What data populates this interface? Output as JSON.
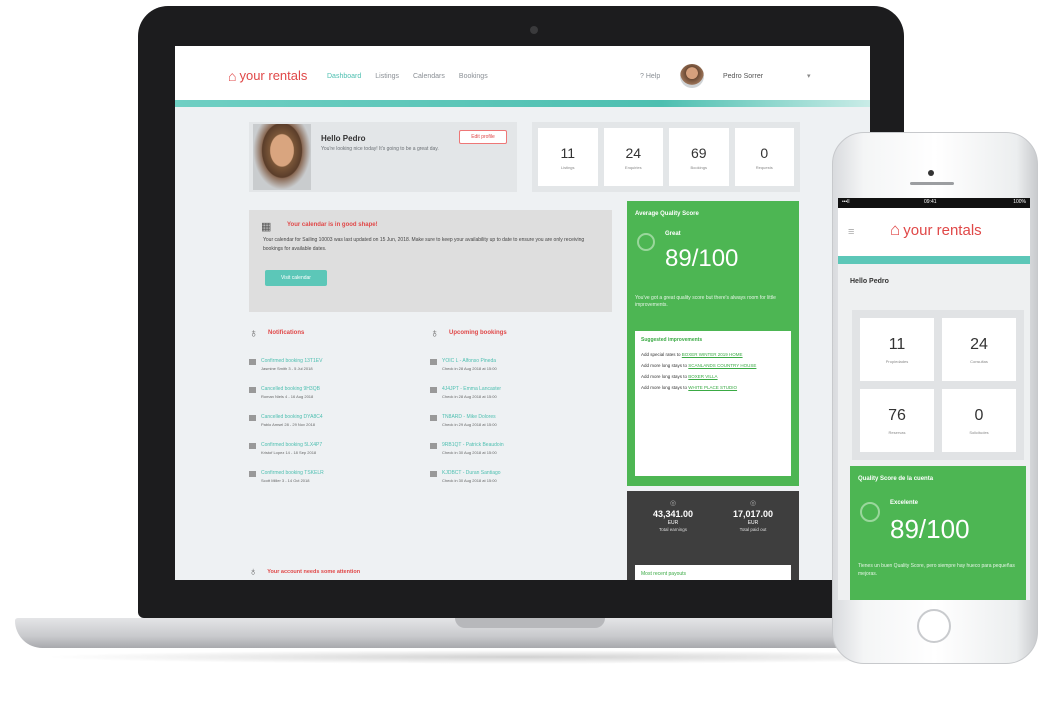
{
  "brand": {
    "name": "your rentals",
    "accent": "#e04848",
    "teal": "#4dbfb0",
    "green": "#4db653"
  },
  "nav": {
    "links": [
      "Dashboard",
      "Listings",
      "Calendars",
      "Bookings"
    ],
    "help": "Help",
    "username": "Pedro Sorrer"
  },
  "profile": {
    "greeting": "Hello Pedro",
    "subtitle": "You're looking nice today! It's going to be a great day.",
    "edit_button": "Edit profile"
  },
  "stats": [
    {
      "value": "11",
      "label": "Listings"
    },
    {
      "value": "24",
      "label": "Enquiries"
    },
    {
      "value": "69",
      "label": "Bookings"
    },
    {
      "value": "0",
      "label": "Requests"
    }
  ],
  "calendar_alert": {
    "title": "Your calendar is in good shape!",
    "body": "Your calendar for Sailing 10003 was last updated on 15 Jun, 2018. Make sure to keep your availability up to date to ensure you are only receiving bookings for available dates.",
    "button": "Visit calendar"
  },
  "quality": {
    "title": "Average Quality Score",
    "level": "Great",
    "value": "89/100",
    "subtitle": "You've got a great quality score but there's always room for little improvements.",
    "box_title": "Suggested improvements",
    "tips": [
      {
        "text": "Add special rates to",
        "link": "BOXER WINTER 2019 HOME"
      },
      {
        "text": "Add more long stays to",
        "link": "SCANLANDS COUNTRY HOUSE"
      },
      {
        "text": "Add more long stays to",
        "link": "BOXER VILLA"
      },
      {
        "text": "Add more long stays to",
        "link": "WHITE PLACE STUDIO"
      }
    ]
  },
  "earnings": {
    "total": {
      "value": "43,341.00",
      "currency": "EUR",
      "label": "Total earnings"
    },
    "paid": {
      "value": "17,017.00",
      "currency": "EUR",
      "label": "Total paid out"
    },
    "link": "Most recent payouts"
  },
  "notifications": {
    "title": "Notifications",
    "items": [
      {
        "main": "Confirmed booking 13T1EV",
        "sub": "Jasmine Smith 3 - 5 Jul 2018"
      },
      {
        "main": "Cancelled booking 9H3QB",
        "sub": "Roman Niels 4 - 16 Aug 2018"
      },
      {
        "main": "Cancelled booking DYA8C4",
        "sub": "Pablo Amsel 28 - 29 Nov 2018"
      },
      {
        "main": "Confirmed booking 5LX4P7",
        "sub": "Kristof Lopez 14 - 18 Sep 2018"
      },
      {
        "main": "Confirmed booking TSKELR",
        "sub": "Scott Miller 3 - 14 Oct 2018"
      }
    ]
  },
  "upcoming": {
    "title": "Upcoming bookings",
    "items": [
      {
        "main": "YOIC L - Alfonso Pineda",
        "sub": "Check in 28 Aug 2018 at 15:00"
      },
      {
        "main": "4J4JPT - Emma Lancaster",
        "sub": "Check in 28 Aug 2018 at 15:00"
      },
      {
        "main": "TN8ARD - Mike Dolores",
        "sub": "Check in 29 Aug 2018 at 15:00"
      },
      {
        "main": "9RB1QT - Patrick Beaudoin",
        "sub": "Check in 30 Aug 2018 at 15:00"
      },
      {
        "main": "KJDBCT - Duran Santiago",
        "sub": "Check in 30 Aug 2018 at 15:00"
      }
    ]
  },
  "attention": "Your account needs some attention",
  "phone": {
    "status_left": "•••ll",
    "status_center": "09:41",
    "status_right": "100%",
    "hello": "Hello Pedro",
    "stats": [
      {
        "value": "11",
        "label": "Propiedades"
      },
      {
        "value": "24",
        "label": "Consultas"
      },
      {
        "value": "76",
        "label": "Reservas"
      },
      {
        "value": "0",
        "label": "Solicitudes"
      }
    ],
    "qs_title": "Quality Score de la cuenta",
    "qs_level": "Excelente",
    "qs_value": "89/100",
    "qs_sub": "Tienes un buen Quality Score, pero siempre hay hueco para pequeñas mejoras."
  }
}
